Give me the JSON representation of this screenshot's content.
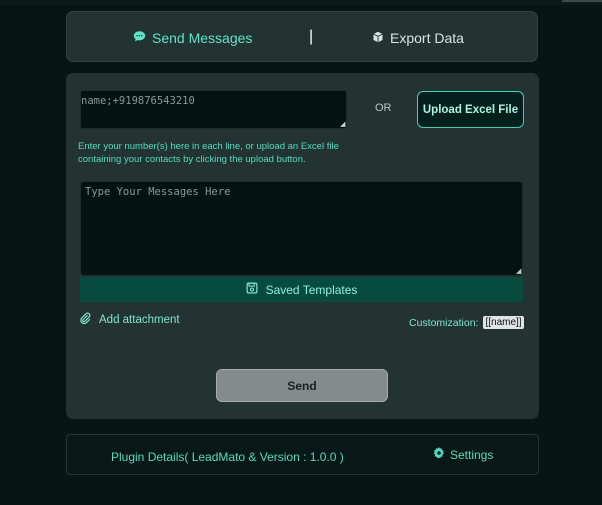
{
  "nav": {
    "send_label": "Send Messages",
    "separator": "|",
    "export_label": "Export Data"
  },
  "numbers": {
    "placeholder": "name;+919876543210",
    "value": ""
  },
  "or_label": "OR",
  "upload_label": "Upload Excel File",
  "hint": "Enter your number(s) here in each line, or upload an Excel file containing your contacts by clicking the upload button.",
  "message": {
    "placeholder": "Type Your Messages Here",
    "value": ""
  },
  "templates_label": "Saved Templates",
  "attachment_label": "Add attachment",
  "customization": {
    "label": "Customization:",
    "tag": "[[name]]"
  },
  "send_label": "Send",
  "footer": {
    "plugin_details": "Plugin Details( LeadMato & Version : 1.0.0 )",
    "settings_label": "Settings"
  },
  "colors": {
    "accent": "#5fe3c9",
    "panel": "#223331",
    "background": "#071514",
    "template_bar": "#074a3e"
  },
  "icons": [
    "chat-bubble-icon",
    "box-icon",
    "save-icon",
    "paperclip-icon",
    "gear-icon",
    "resize-grip-icon"
  ]
}
